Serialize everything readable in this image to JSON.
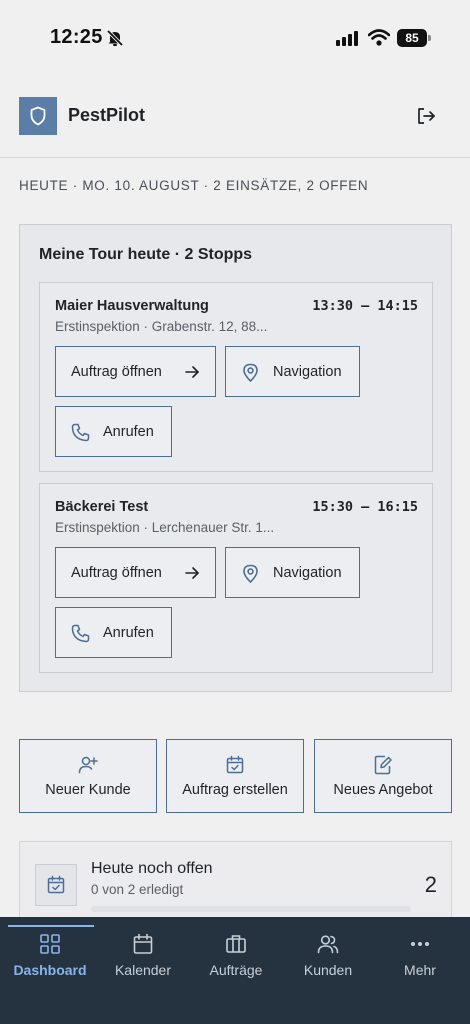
{
  "status_bar": {
    "time": "12:25",
    "battery": "85"
  },
  "header": {
    "app_title": "PestPilot"
  },
  "date_line": "HEUTE · MO. 10. AUGUST · 2 EINSÄTZE, 2 OFFEN",
  "tour": {
    "title": "Meine Tour heute · 2 Stopps",
    "stops": [
      {
        "name": "Maier Hausverwaltung",
        "time": "13:30 – 14:15",
        "subtitle": "Erstinspektion · Grabenstr. 12, 88...",
        "open_label": "Auftrag öffnen",
        "nav_label": "Navigation",
        "call_label": "Anrufen"
      },
      {
        "name": "Bäckerei Test",
        "time": "15:30 – 16:15",
        "subtitle": "Erstinspektion · Lerchenauer Str. 1...",
        "open_label": "Auftrag öffnen",
        "nav_label": "Navigation",
        "call_label": "Anrufen"
      }
    ]
  },
  "quick_actions": [
    {
      "label": "Neuer Kunde",
      "icon": "user-plus-icon"
    },
    {
      "label": "Auftrag erstellen",
      "icon": "calendar-check-icon"
    },
    {
      "label": "Neues Angebot",
      "icon": "document-edit-icon"
    }
  ],
  "open_today": {
    "title": "Heute noch offen",
    "subtitle": "0 von 2 erledigt",
    "count": "2",
    "progress": 0
  },
  "bottom_nav": {
    "items": [
      {
        "label": "Dashboard",
        "icon": "grid-icon",
        "active": true
      },
      {
        "label": "Kalender",
        "icon": "calendar-icon",
        "active": false
      },
      {
        "label": "Aufträge",
        "icon": "briefcase-icon",
        "active": false
      },
      {
        "label": "Kunden",
        "icon": "users-icon",
        "active": false
      },
      {
        "label": "Mehr",
        "icon": "more-icon",
        "active": false
      }
    ]
  },
  "colors": {
    "accent": "#5a7ea8",
    "button_border": "#4c6e96",
    "nav_background": "#253240",
    "nav_active": "#8ab4e8"
  }
}
